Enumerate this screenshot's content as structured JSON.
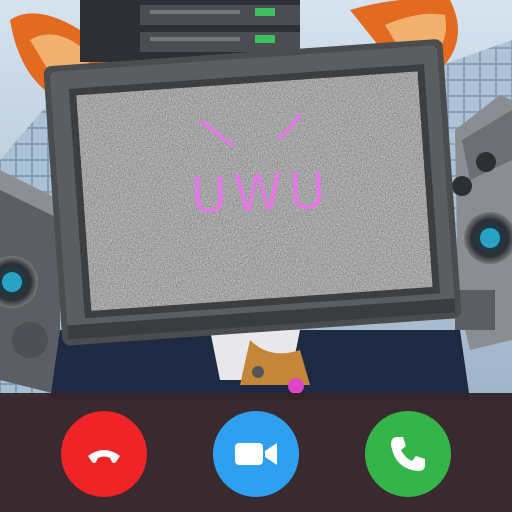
{
  "screen": {
    "face_text": "UWU"
  },
  "call_actions": [
    {
      "id": "decline",
      "icon": "phone-hangup-icon",
      "color": "#ef2426"
    },
    {
      "id": "video",
      "icon": "video-camera-icon",
      "color": "#2f9ff0"
    },
    {
      "id": "accept",
      "icon": "phone-icon",
      "color": "#34b449"
    }
  ],
  "colors": {
    "callbar_bg": "#342428",
    "tv_frame": "#56585a",
    "face_pink": "#e07ae0"
  }
}
